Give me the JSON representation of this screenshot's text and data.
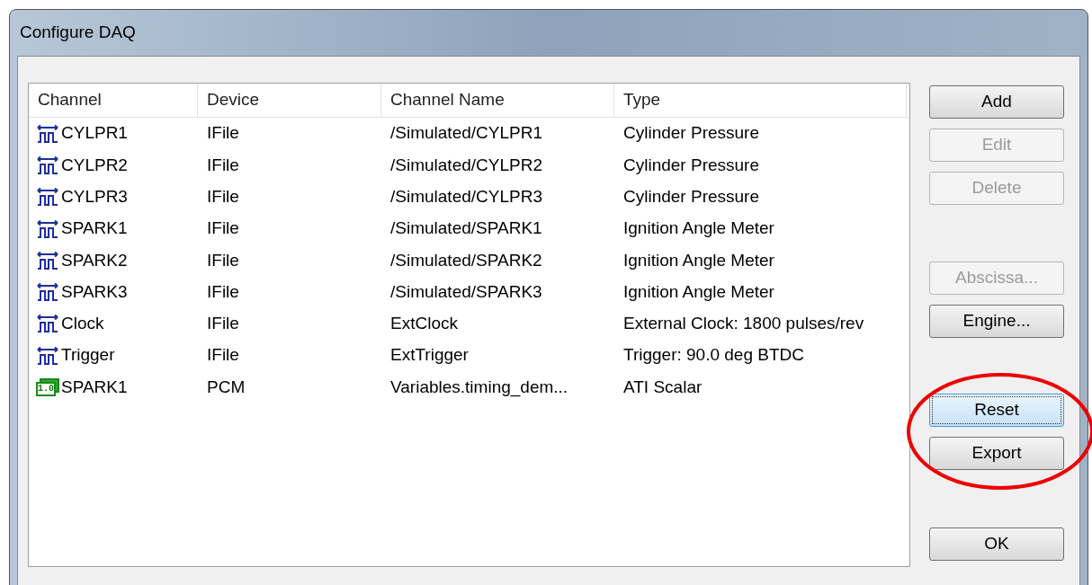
{
  "window": {
    "title": "Configure DAQ"
  },
  "table": {
    "columns": [
      "Channel",
      "Device",
      "Channel Name",
      "Type"
    ],
    "rows": [
      {
        "kind": "signal",
        "cells": [
          "CYLPR1",
          "IFile",
          "/Simulated/CYLPR1",
          "Cylinder Pressure"
        ]
      },
      {
        "kind": "signal",
        "cells": [
          "CYLPR2",
          "IFile",
          "/Simulated/CYLPR2",
          "Cylinder Pressure"
        ]
      },
      {
        "kind": "signal",
        "cells": [
          "CYLPR3",
          "IFile",
          "/Simulated/CYLPR3",
          "Cylinder Pressure"
        ]
      },
      {
        "kind": "signal",
        "cells": [
          "SPARK1",
          "IFile",
          "/Simulated/SPARK1",
          "Ignition Angle Meter"
        ]
      },
      {
        "kind": "signal",
        "cells": [
          "SPARK2",
          "IFile",
          "/Simulated/SPARK2",
          "Ignition Angle Meter"
        ]
      },
      {
        "kind": "signal",
        "cells": [
          "SPARK3",
          "IFile",
          "/Simulated/SPARK3",
          "Ignition Angle Meter"
        ]
      },
      {
        "kind": "signal",
        "cells": [
          "Clock",
          "IFile",
          "ExtClock",
          "External Clock: 1800 pulses/rev"
        ]
      },
      {
        "kind": "signal",
        "cells": [
          "Trigger",
          "IFile",
          "ExtTrigger",
          "Trigger: 90.0 deg BTDC"
        ]
      },
      {
        "kind": "scalar",
        "icon_text": "1.0",
        "cells": [
          "SPARK1",
          "PCM",
          "Variables.timing_dem...",
          "ATI Scalar"
        ]
      }
    ]
  },
  "buttons": [
    {
      "label": "Add",
      "disabled": false,
      "focused": false
    },
    {
      "label": "Edit",
      "disabled": true,
      "focused": false
    },
    {
      "label": "Delete",
      "disabled": true,
      "focused": false
    },
    {
      "label": "Abscissa...",
      "disabled": true,
      "focused": false
    },
    {
      "label": "Engine...",
      "disabled": false,
      "focused": false
    },
    {
      "label": "Reset",
      "disabled": false,
      "focused": true
    },
    {
      "label": "Export",
      "disabled": false,
      "focused": false
    },
    {
      "label": "OK",
      "disabled": false,
      "focused": false
    }
  ]
}
